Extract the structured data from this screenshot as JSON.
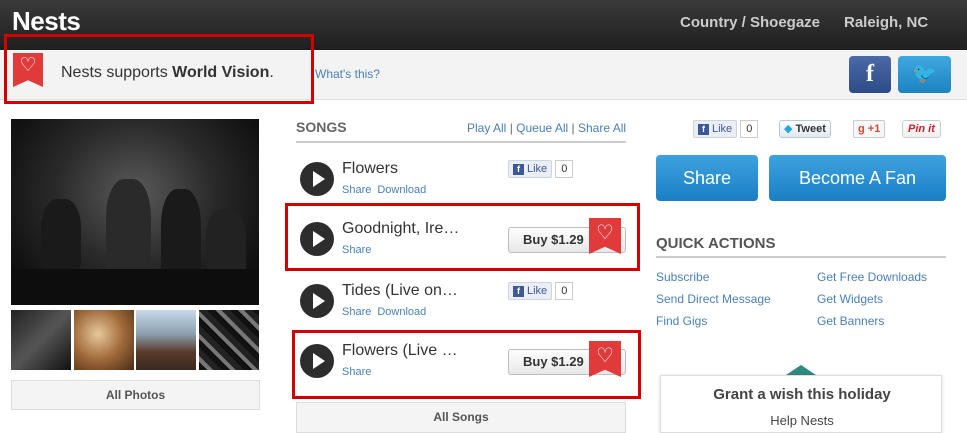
{
  "header": {
    "brand": "Nests",
    "genre": "Country / Shoegaze",
    "location": "Raleigh, NC"
  },
  "charity": {
    "prefix": "Nests supports ",
    "org": "World Vision",
    "suffix": ".",
    "whats_this": "What's this?"
  },
  "social_top": {
    "facebook_glyph": "f",
    "twitter_glyph": "🐦"
  },
  "photos": {
    "all_label": "All Photos"
  },
  "songs": {
    "heading": "SONGS",
    "play_all": "Play All",
    "queue_all": "Queue All",
    "share_all": "Share All",
    "separator": " | ",
    "items": [
      {
        "title": "Flowers",
        "share": "Share",
        "download": "Download",
        "like": "Like",
        "likes": "0"
      },
      {
        "title": "Goodnight, Ire…",
        "share": "Share",
        "buy": "Buy $1.29"
      },
      {
        "title": "Tides (Live on…",
        "share": "Share",
        "download": "Download",
        "like": "Like",
        "likes": "0"
      },
      {
        "title": "Flowers (Live …",
        "share": "Share",
        "buy": "Buy $1.29"
      }
    ],
    "all_label": "All Songs"
  },
  "social_share": {
    "like": "Like",
    "like_count": "0",
    "tweet": "Tweet",
    "gplus": "+1",
    "pinit": "Pin it"
  },
  "actions": {
    "share": "Share",
    "fan": "Become A Fan"
  },
  "quick_actions": {
    "title": "QUICK ACTIONS",
    "left": [
      "Subscribe",
      "Send Direct Message",
      "Find Gigs"
    ],
    "right": [
      "Get Free Downloads",
      "Get Widgets",
      "Get Banners"
    ]
  },
  "wish": {
    "title": "Grant a wish this holiday",
    "subtitle": "Help Nests"
  },
  "colors": {
    "accent_blue": "#1a7fc3",
    "link_blue": "#4a7fb8",
    "charity_red": "#e03a3a",
    "highlight_red": "#d40000"
  }
}
